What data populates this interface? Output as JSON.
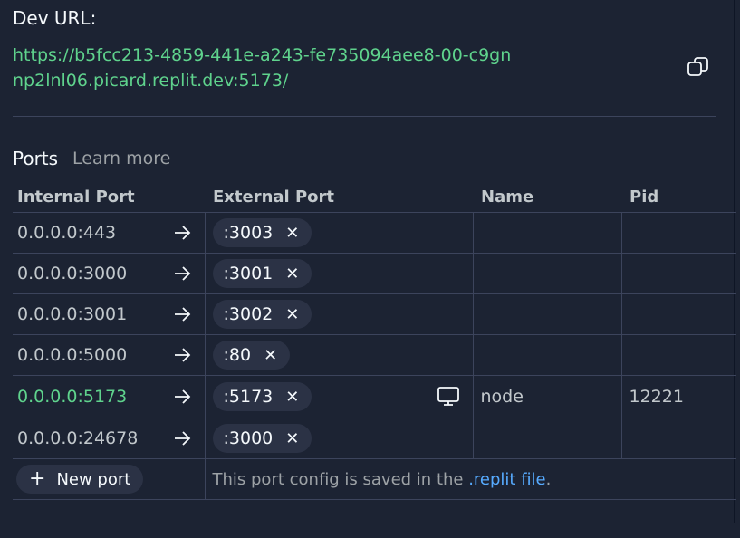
{
  "dev": {
    "label": "Dev URL:",
    "url": "https://b5fcc213-4859-441e-a243-fe735094aee8-00-c9gnnp2lnl06.picard.replit.dev:5173/"
  },
  "ports": {
    "title": "Ports",
    "learn_more": "Learn more",
    "headers": {
      "internal": "Internal Port",
      "external": "External Port",
      "name": "Name",
      "pid": "Pid"
    },
    "rows": [
      {
        "internal": "0.0.0.0:443",
        "external": ":3003",
        "name": "",
        "pid": ""
      },
      {
        "internal": "0.0.0.0:3000",
        "external": ":3001",
        "name": "",
        "pid": ""
      },
      {
        "internal": "0.0.0.0:3001",
        "external": ":3002",
        "name": "",
        "pid": ""
      },
      {
        "internal": "0.0.0.0:5000",
        "external": ":80",
        "name": "",
        "pid": ""
      },
      {
        "internal": "0.0.0.0:5173",
        "external": ":5173",
        "name": "node",
        "pid": "12221"
      },
      {
        "internal": "0.0.0.0:24678",
        "external": ":3000",
        "name": "",
        "pid": ""
      }
    ],
    "new_port_label": "New port",
    "footer_text": "This port config is saved in the ",
    "footer_link": ".replit file",
    "footer_end": "."
  },
  "icons": {
    "remove": "✕",
    "add": "+"
  },
  "colors": {
    "background": "#1c2333",
    "accent_green": "#5fd38d",
    "link_blue": "#57abff",
    "chip_bg": "#2b3245"
  }
}
